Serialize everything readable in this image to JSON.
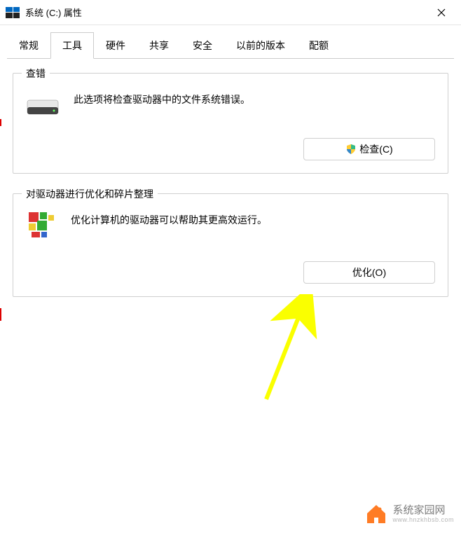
{
  "window": {
    "title": "系统 (C:) 属性"
  },
  "tabs": {
    "general": "常规",
    "tools": "工具",
    "hardware": "硬件",
    "sharing": "共享",
    "security": "安全",
    "previous": "以前的版本",
    "quota": "配额"
  },
  "errorCheck": {
    "title": "查错",
    "desc": "此选项将检查驱动器中的文件系统错误。",
    "button": "检查(C)"
  },
  "optimize": {
    "title": "对驱动器进行优化和碎片整理",
    "desc": "优化计算机的驱动器可以帮助其更高效运行。",
    "button": "优化(O)"
  },
  "watermark": {
    "text": "系统家园网",
    "sub": "www.hnzkhbsb.com"
  }
}
